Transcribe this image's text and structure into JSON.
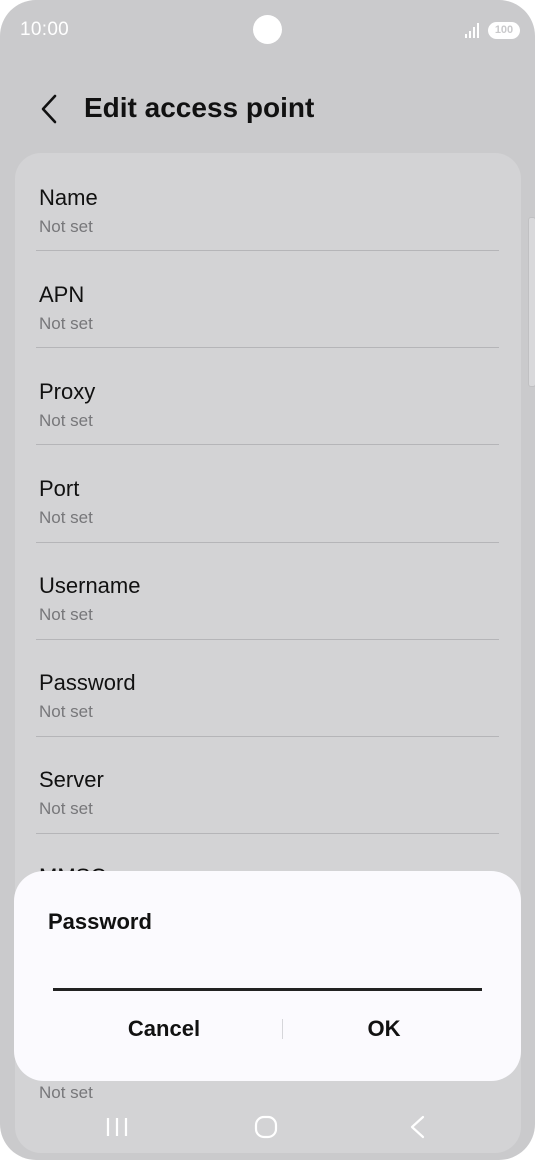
{
  "status_bar": {
    "time": "10:00",
    "battery": "100"
  },
  "header": {
    "title": "Edit access point"
  },
  "fields": [
    {
      "label": "Name",
      "value": "Not set"
    },
    {
      "label": "APN",
      "value": "Not set"
    },
    {
      "label": "Proxy",
      "value": "Not set"
    },
    {
      "label": "Port",
      "value": "Not set"
    },
    {
      "label": "Username",
      "value": "Not set"
    },
    {
      "label": "Password",
      "value": "Not set"
    },
    {
      "label": "Server",
      "value": "Not set"
    },
    {
      "label": "MMSC",
      "value": ""
    }
  ],
  "peek_value": "Not set",
  "dialog": {
    "title": "Password",
    "input_value": "",
    "cancel_label": "Cancel",
    "ok_label": "OK"
  },
  "nav": {
    "recent": "recent-apps-icon",
    "home": "home-icon",
    "back": "back-icon"
  }
}
